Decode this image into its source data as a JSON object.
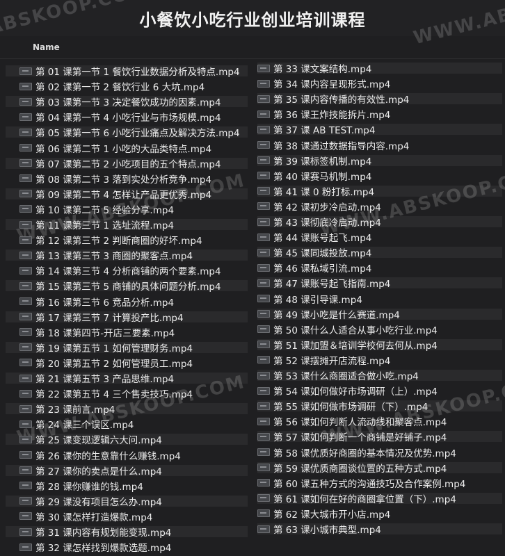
{
  "page_title": "小餐饮小吃行业创业培训课程",
  "header": {
    "name_col": "Name"
  },
  "watermark": "WWW.ABSKOOP.COM",
  "left_files": [
    "第 01 课第一节 1 餐饮行业数据分析及特点.mp4",
    "第 02 课第一节 2 餐饮行业 6 大坑.mp4",
    "第 03 课第一节 3 决定餐饮成功的因素.mp4",
    "第 04 课第一节 4 小吃行业与市场规模.mp4",
    "第 05 课第一节 6 小吃行业痛点及解决方法.mp4",
    "第 06 课第二节 1 小吃的大品类特点.mp4",
    "第 07 课第二节 2 小吃项目的五个特点.mp4",
    "第 08 课第二节 3 落到实处分析竞争.mp4",
    "第 09 课第二节 4 怎样让产品更优秀.mp4",
    "第 10 课第二节 5 经验分享.mp4",
    "第 11 课第三节 1 选址流程.mp4",
    "第 12 课第三节 2 判断商圈的好坏.mp4",
    "第 13 课第三节 3 商圈的聚客点.mp4",
    "第 14 课第三节 4 分析商铺的两个要素.mp4",
    "第 15 课第三节 5 商铺的具体问题分析.mp4",
    "第 16 课第三节 6 竞品分析.mp4",
    "第 17 课第三节 7 计算投产比.mp4",
    "第 18 课第四节-开店三要素.mp4",
    "第 19 课第五节 1 如何管理财务.mp4",
    "第 20 课第五节 2 如何管理员工.mp4",
    "第 21 课第五节 3 产品思维.mp4",
    "第 22 课第五节 4 三个售卖技巧.mp4",
    "第 23 课前言.mp4",
    "第 24 课三个误区.mp4",
    "第 25 课变现逻辑六大问.mp4",
    "第 26 课你的生意靠什么赚钱.mp4",
    "第 27 课你的卖点是什么.mp4",
    "第 28 课你赚谁的钱.mp4",
    "第 29 课没有项目怎么办.mp4",
    "第 30 课怎样打造爆款.mp4",
    "第 31 课内容有规划能变现.mp4",
    "第 32 课怎样找到爆款选题.mp4"
  ],
  "right_files": [
    "第 33 课文案结构.mp4",
    "第 34 课内容呈现形式.mp4",
    "第 35 课内容传播的有效性.mp4",
    "第 36 课王炸技能拆片.mp4",
    "第 37 课 AB TEST.mp4",
    "第 38 课通过数据指导内容.mp4",
    "第 39 课标签机制.mp4",
    "第 40 课赛马机制.mp4",
    "第 41 课 0 粉打标.mp4",
    "第 42 课初步冷启动.mp4",
    "第 43 课彻底冷启动.mp4",
    "第 44 课账号起飞.mp4",
    "第 45 课同城投放.mp4",
    "第 46 课私域引流.mp4",
    "第 47 课账号起飞指南.mp4",
    "第 48 课引导课.mp4",
    "第 49 课小吃是什么赛道.mp4",
    "第 50 课什么人适合从事小吃行业.mp4",
    "第 51 课加盟＆培训学校何去何从.mp4",
    "第 52 课摆摊开店流程.mp4",
    "第 53 课什么商圈适合做小吃.mp4",
    "第 54 课如何做好市场调研（上）.mp4",
    "第 55 课如何做市场调研（下）.mp4",
    "第 56 课如何判断人流动线和聚客点.mp4",
    "第 57 课如何判断一个商铺是好铺子.mp4",
    "第 58 课优质好商圈的基本情况及优势.mp4",
    "第 59 课优质商圈谈位置的五种方式.mp4",
    "第 60 课五种方式的沟通技巧及合作案例.mp4",
    "第 61 课如何在好的商圈拿位置（下）.mp4",
    "第 62 课大城市开小店.mp4",
    "第 63 课小城市典型.mp4"
  ]
}
